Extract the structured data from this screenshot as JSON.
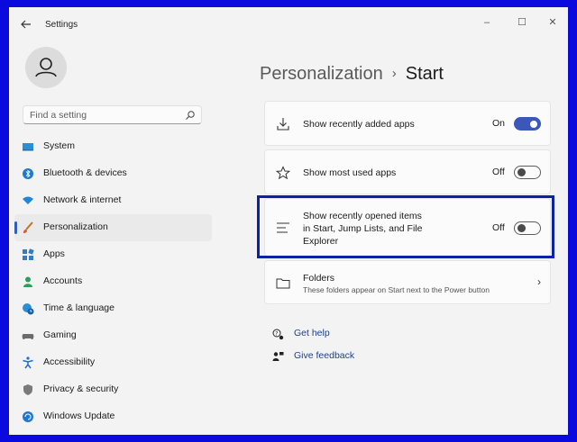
{
  "window": {
    "title": "Settings",
    "controls": {
      "minimize": "–",
      "maximize": "☐",
      "close": "✕"
    }
  },
  "search": {
    "placeholder": "Find a setting"
  },
  "nav": [
    {
      "label": "System",
      "icon": "monitor-icon"
    },
    {
      "label": "Bluetooth & devices",
      "icon": "bluetooth-icon"
    },
    {
      "label": "Network & internet",
      "icon": "wifi-icon"
    },
    {
      "label": "Personalization",
      "icon": "brush-icon",
      "active": true
    },
    {
      "label": "Apps",
      "icon": "apps-icon"
    },
    {
      "label": "Accounts",
      "icon": "account-icon"
    },
    {
      "label": "Time & language",
      "icon": "globe-clock-icon"
    },
    {
      "label": "Gaming",
      "icon": "gamepad-icon"
    },
    {
      "label": "Accessibility",
      "icon": "accessibility-icon"
    },
    {
      "label": "Privacy & security",
      "icon": "shield-icon"
    },
    {
      "label": "Windows Update",
      "icon": "update-icon"
    }
  ],
  "breadcrumb": {
    "parent": "Personalization",
    "separator": "›",
    "current": "Start"
  },
  "settings": [
    {
      "label": "Show recently added apps",
      "state": "On",
      "on": true,
      "icon": "download-icon"
    },
    {
      "label": "Show most used apps",
      "state": "Off",
      "on": false,
      "icon": "star-icon"
    },
    {
      "label": "Show recently opened items in Start, Jump Lists, and File Explorer",
      "line1": "Show recently opened items",
      "line2": "in Start, Jump Lists, and File",
      "line3": "Explorer",
      "state": "Off",
      "on": false,
      "icon": "list-icon"
    }
  ],
  "folders": {
    "title": "Folders",
    "subtitle": "These folders appear on Start next to the Power button",
    "icon": "folder-icon"
  },
  "links": {
    "help": "Get help",
    "feedback": "Give feedback"
  },
  "colors": {
    "accent": "#3b57b9",
    "highlight": "#0b21a8",
    "background": "#f3f3f3",
    "frame": "#0a0adf"
  }
}
